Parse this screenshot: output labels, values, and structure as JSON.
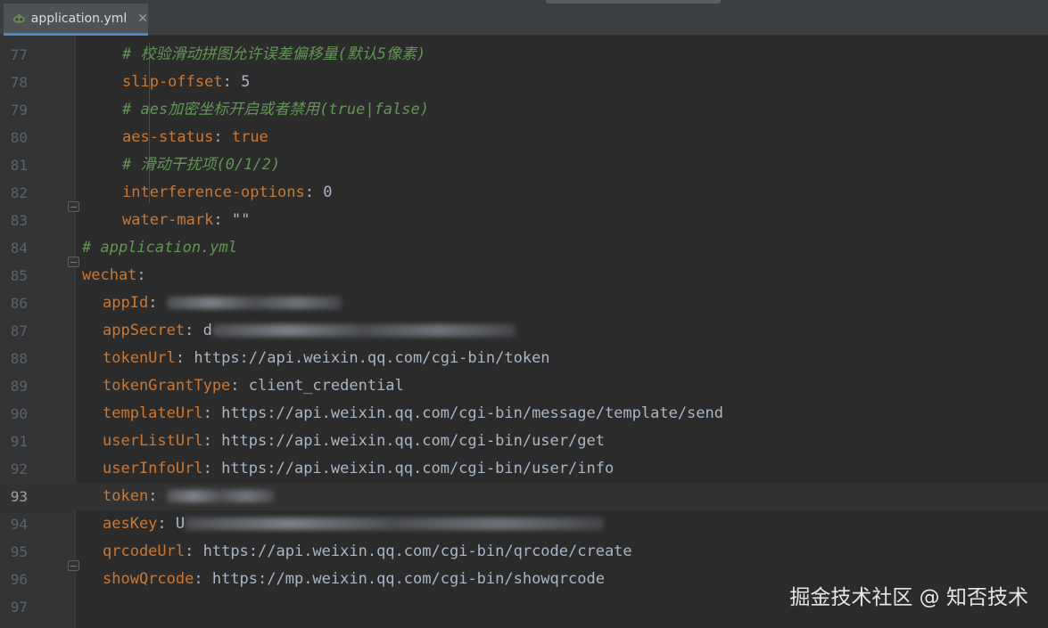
{
  "tab": {
    "filename": "application.yml",
    "close": "✕"
  },
  "lines": [
    {
      "n": "77",
      "indent": 2,
      "segments": [
        {
          "t": "cmt",
          "v": "# 校验滑动拼图允许误差偏移量(默认5像素)"
        }
      ]
    },
    {
      "n": "78",
      "indent": 2,
      "segments": [
        {
          "t": "key",
          "v": "slip-offset"
        },
        {
          "t": "punc",
          "v": ": "
        },
        {
          "t": "val",
          "v": "5"
        }
      ]
    },
    {
      "n": "79",
      "indent": 2,
      "segments": [
        {
          "t": "cmt",
          "v": "# aes加密坐标开启或者禁用(true|false)"
        }
      ]
    },
    {
      "n": "80",
      "indent": 2,
      "segments": [
        {
          "t": "key",
          "v": "aes-status"
        },
        {
          "t": "punc",
          "v": ": "
        },
        {
          "t": "key",
          "v": "true"
        }
      ]
    },
    {
      "n": "81",
      "indent": 2,
      "segments": [
        {
          "t": "cmt",
          "v": "# 滑动干扰项(0/1/2)"
        }
      ]
    },
    {
      "n": "82",
      "indent": 2,
      "segments": [
        {
          "t": "key",
          "v": "interference-options"
        },
        {
          "t": "punc",
          "v": ": "
        },
        {
          "t": "val",
          "v": "0"
        }
      ]
    },
    {
      "n": "83",
      "indent": 2,
      "segments": [
        {
          "t": "key",
          "v": "water-mark"
        },
        {
          "t": "punc",
          "v": ": "
        },
        {
          "t": "val",
          "v": "\"\""
        }
      ]
    },
    {
      "n": "84",
      "indent": 0,
      "segments": [
        {
          "t": "cmt",
          "v": "# application.yml"
        }
      ]
    },
    {
      "n": "85",
      "indent": 0,
      "segments": [
        {
          "t": "key",
          "v": "wechat"
        },
        {
          "t": "punc",
          "v": ":"
        }
      ]
    },
    {
      "n": "86",
      "indent": 1,
      "segments": [
        {
          "t": "key",
          "v": "appId"
        },
        {
          "t": "punc",
          "v": ": "
        },
        {
          "t": "blur",
          "v": "196"
        }
      ]
    },
    {
      "n": "87",
      "indent": 1,
      "segments": [
        {
          "t": "key",
          "v": "appSecret"
        },
        {
          "t": "punc",
          "v": ": "
        },
        {
          "t": "val",
          "v": "d"
        },
        {
          "t": "blur",
          "v": "340"
        }
      ]
    },
    {
      "n": "88",
      "indent": 1,
      "segments": [
        {
          "t": "key",
          "v": "tokenUrl"
        },
        {
          "t": "punc",
          "v": ": "
        },
        {
          "t": "val",
          "v": "https://api.weixin.qq.com/cgi-bin/token"
        }
      ]
    },
    {
      "n": "89",
      "indent": 1,
      "segments": [
        {
          "t": "key",
          "v": "tokenGrantType"
        },
        {
          "t": "punc",
          "v": ": "
        },
        {
          "t": "val",
          "v": "client_credential"
        }
      ]
    },
    {
      "n": "90",
      "indent": 1,
      "segments": [
        {
          "t": "key",
          "v": "templateUrl"
        },
        {
          "t": "punc",
          "v": ": "
        },
        {
          "t": "val",
          "v": "https://api.weixin.qq.com/cgi-bin/message/template/send"
        }
      ]
    },
    {
      "n": "91",
      "indent": 1,
      "segments": [
        {
          "t": "key",
          "v": "userListUrl"
        },
        {
          "t": "punc",
          "v": ": "
        },
        {
          "t": "val",
          "v": "https://api.weixin.qq.com/cgi-bin/user/get"
        }
      ]
    },
    {
      "n": "92",
      "indent": 1,
      "segments": [
        {
          "t": "key",
          "v": "userInfoUrl"
        },
        {
          "t": "punc",
          "v": ": "
        },
        {
          "t": "val",
          "v": "https://api.weixin.qq.com/cgi-bin/user/info"
        }
      ]
    },
    {
      "n": "93",
      "indent": 1,
      "current": true,
      "segments": [
        {
          "t": "key",
          "v": "token"
        },
        {
          "t": "punc",
          "v": ": "
        },
        {
          "t": "blur",
          "v": "120"
        }
      ]
    },
    {
      "n": "94",
      "indent": 1,
      "segments": [
        {
          "t": "key",
          "v": "aesKey"
        },
        {
          "t": "punc",
          "v": ": "
        },
        {
          "t": "val",
          "v": "U"
        },
        {
          "t": "blur",
          "v": "470"
        }
      ]
    },
    {
      "n": "95",
      "indent": 1,
      "segments": [
        {
          "t": "key",
          "v": "qrcodeUrl"
        },
        {
          "t": "punc",
          "v": ": "
        },
        {
          "t": "val",
          "v": "https://api.weixin.qq.com/cgi-bin/qrcode/create"
        }
      ]
    },
    {
      "n": "96",
      "indent": 1,
      "segments": [
        {
          "t": "key",
          "v": "showQrcode"
        },
        {
          "t": "punc",
          "v": ": "
        },
        {
          "t": "val",
          "v": "https://mp.weixin.qq.com/cgi-bin/showqrcode"
        }
      ]
    },
    {
      "n": "97",
      "indent": 0,
      "segments": []
    }
  ],
  "watermark": "掘金技术社区 @ 知否技术"
}
